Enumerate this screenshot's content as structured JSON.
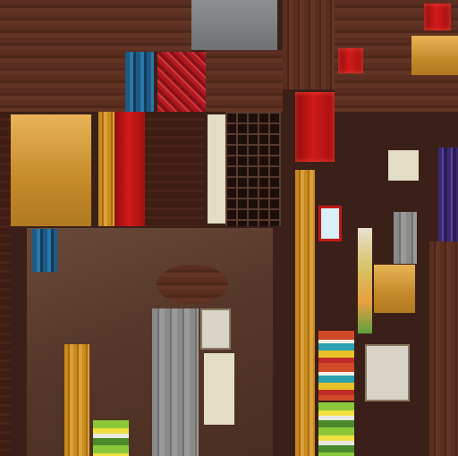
{
  "atlas": {
    "tiles": [
      {
        "name": "wood-wall-top-left",
        "cls": "wood"
      },
      {
        "name": "brown-panel-left-column",
        "cls": "plank-dark"
      },
      {
        "name": "amber-window-panel",
        "cls": "amber"
      },
      {
        "name": "gold-wood-column",
        "cls": "gold-v"
      },
      {
        "name": "red-curtain",
        "cls": "red-panel"
      },
      {
        "name": "dark-window-grid",
        "cls": "grid-window"
      },
      {
        "name": "cream-lights-column",
        "cls": "cream"
      },
      {
        "name": "blue-books-stack",
        "cls": "books"
      },
      {
        "name": "red-books-stack",
        "cls": "books-red"
      },
      {
        "name": "stone-slab-top",
        "cls": "stone"
      },
      {
        "name": "red-door-panel",
        "cls": "red-panel"
      },
      {
        "name": "gold-crate-top-right",
        "cls": "amber"
      },
      {
        "name": "purple-shelf-right",
        "cls": "purple"
      },
      {
        "name": "wood-floor-right",
        "cls": "wood-v"
      },
      {
        "name": "poster-stack-red-teal",
        "cls": "poster-stack"
      },
      {
        "name": "poster-stack-green",
        "cls": "poster-green"
      },
      {
        "name": "rainbow-strip",
        "cls": "rainbow"
      },
      {
        "name": "gold-crate-middle",
        "cls": "amber"
      },
      {
        "name": "floor-corridor",
        "cls": "floor-tex"
      },
      {
        "name": "metal-door",
        "cls": "metal"
      },
      {
        "name": "gold-column-center",
        "cls": "gold-v"
      },
      {
        "name": "cream-note-sign",
        "cls": "note"
      },
      {
        "name": "cream-note-small",
        "cls": "note"
      }
    ]
  }
}
